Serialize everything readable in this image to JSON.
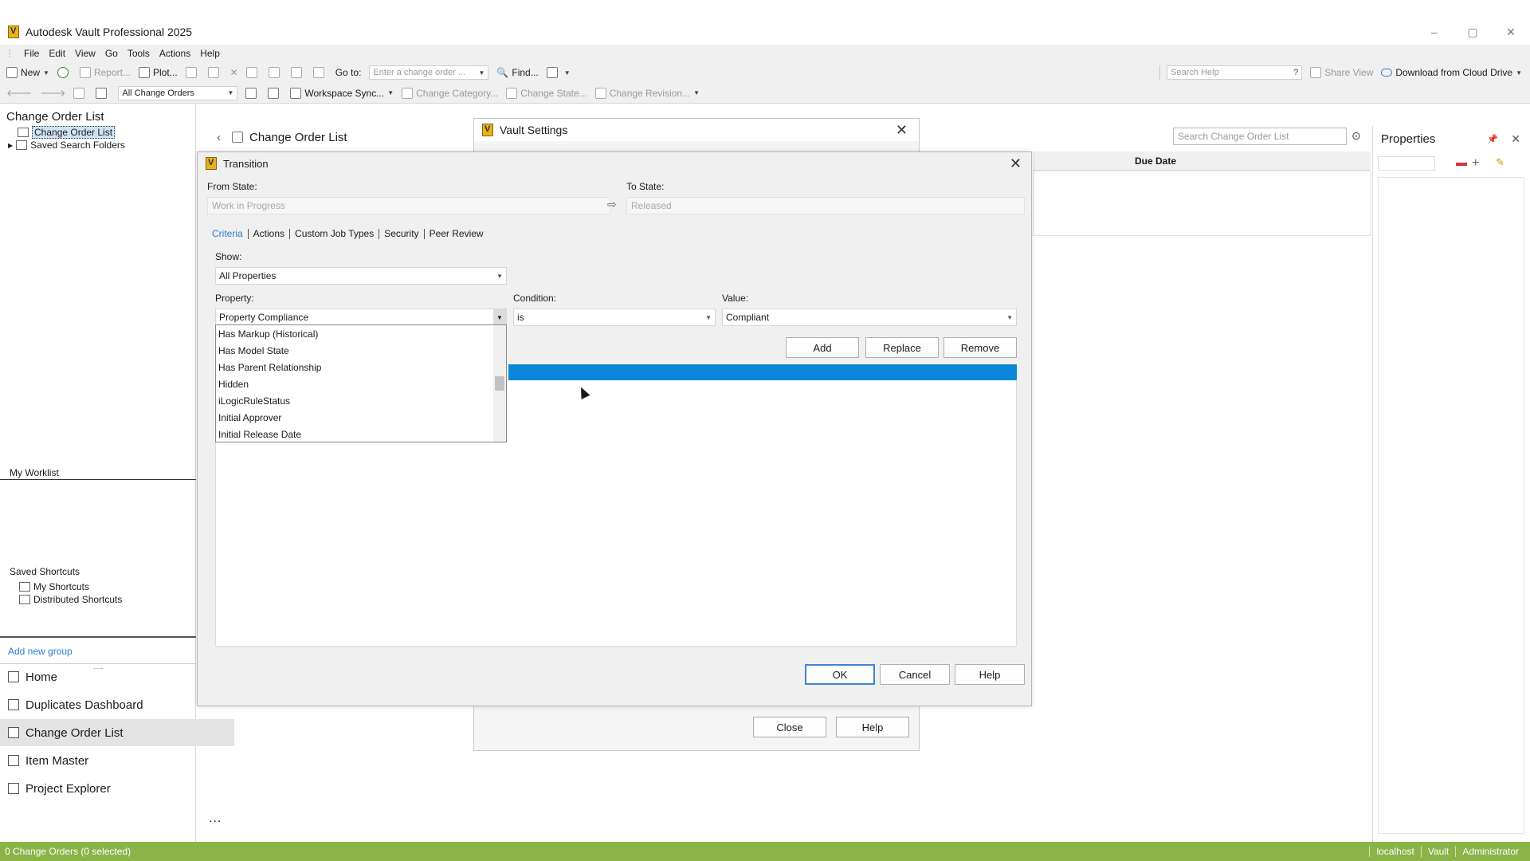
{
  "app": {
    "title": "Autodesk Vault Professional 2025",
    "window_controls": [
      "–",
      "▢",
      "✕"
    ]
  },
  "menu": [
    "File",
    "Edit",
    "View",
    "Go",
    "Tools",
    "Actions",
    "Help"
  ],
  "toolbar1": {
    "new": "New",
    "report": "Report...",
    "plot": "Plot...",
    "goto_label": "Go to:",
    "goto_placeholder": "Enter a change order ...",
    "find": "Find...",
    "search_help_placeholder": "Search Help",
    "share_view": "Share View",
    "download_cloud": "Download from Cloud Drive"
  },
  "toolbar2": {
    "filter_value": "All Change Orders",
    "workspace_sync": "Workspace Sync...",
    "change_category": "Change Category...",
    "change_state": "Change State...",
    "change_revision": "Change Revision..."
  },
  "left_pane": {
    "title": "Change Order List",
    "tree": [
      {
        "label": "Change Order List"
      },
      {
        "label": "Saved Search Folders"
      }
    ],
    "my_worklist": "My Worklist",
    "saved_shortcuts": "Saved Shortcuts",
    "shortcuts": [
      {
        "label": "My Shortcuts"
      },
      {
        "label": "Distributed Shortcuts"
      }
    ],
    "add_new_group": "Add new group",
    "nav": [
      {
        "label": "Home"
      },
      {
        "label": "Duplicates Dashboard"
      },
      {
        "label": "Change Order List"
      },
      {
        "label": "Item Master"
      },
      {
        "label": "Project Explorer"
      }
    ],
    "more": "..."
  },
  "content": {
    "title": "Change Order List",
    "search_placeholder": "Search Change Order List",
    "due_date_header": "Due Date"
  },
  "properties": {
    "title": "Properties"
  },
  "vault_settings": {
    "title": "Vault Settings",
    "close_label": "Close",
    "help_label": "Help"
  },
  "transition": {
    "title": "Transition",
    "from_state_label": "From State:",
    "from_state_value": "Work in Progress",
    "to_state_label": "To State:",
    "to_state_value": "Released",
    "tabs": [
      "Criteria",
      "Actions",
      "Custom Job Types",
      "Security",
      "Peer Review"
    ],
    "show_label": "Show:",
    "show_value": "All Properties",
    "property_label": "Property:",
    "property_value": "Property Compliance",
    "condition_label": "Condition:",
    "condition_value": "is",
    "value_label": "Value:",
    "value_value": "Compliant",
    "dropdown_items": [
      "Has Markup (Historical)",
      "Has Model State",
      "Has Parent Relationship",
      "Hidden",
      "iLogicRuleStatus",
      "Initial Approver",
      "Initial Release Date"
    ],
    "add_label": "Add",
    "replace_label": "Replace",
    "remove_label": "Remove",
    "ok_label": "OK",
    "cancel_label": "Cancel",
    "help_label": "Help"
  },
  "status": {
    "left": "0 Change Orders (0 selected)",
    "server": "localhost",
    "vault": "Vault",
    "user": "Administrator",
    "color": "#8ab447"
  }
}
